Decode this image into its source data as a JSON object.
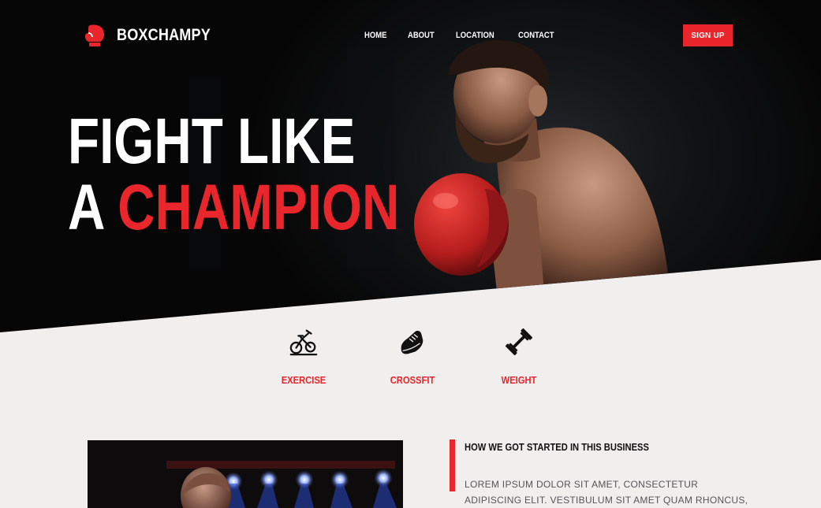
{
  "brand": {
    "name": "BOXCHAMPY",
    "logo_icon": "boxing-glove-icon",
    "accent": "#e8262c"
  },
  "nav": {
    "items": [
      "HOME",
      "ABOUT",
      "LOCATION",
      "CONTACT"
    ]
  },
  "cta": {
    "signup": "SIGN UP"
  },
  "hero": {
    "line1": "FIGHT LIKE",
    "line2_prefix": "A",
    "line2_accent": "CHAMPION"
  },
  "features": [
    {
      "label": "EXERCISE",
      "icon": "exercise-bike-icon"
    },
    {
      "label": "CROSSFIT",
      "icon": "sneaker-icon"
    },
    {
      "label": "WEIGHT",
      "icon": "dumbbell-icon"
    }
  ],
  "about": {
    "title": "HOW WE GOT STARTED IN THIS BUSINESS",
    "text": "LOREM IPSUM DOLOR SIT AMET, CONSECTETUR ADIPISCING ELIT. VESTIBULUM SIT AMET QUAM RHONCUS, EGESTAS DUI"
  },
  "colors": {
    "accent": "#e8262c",
    "hero_bg": "#060606",
    "page_bg": "#f1eeee"
  }
}
